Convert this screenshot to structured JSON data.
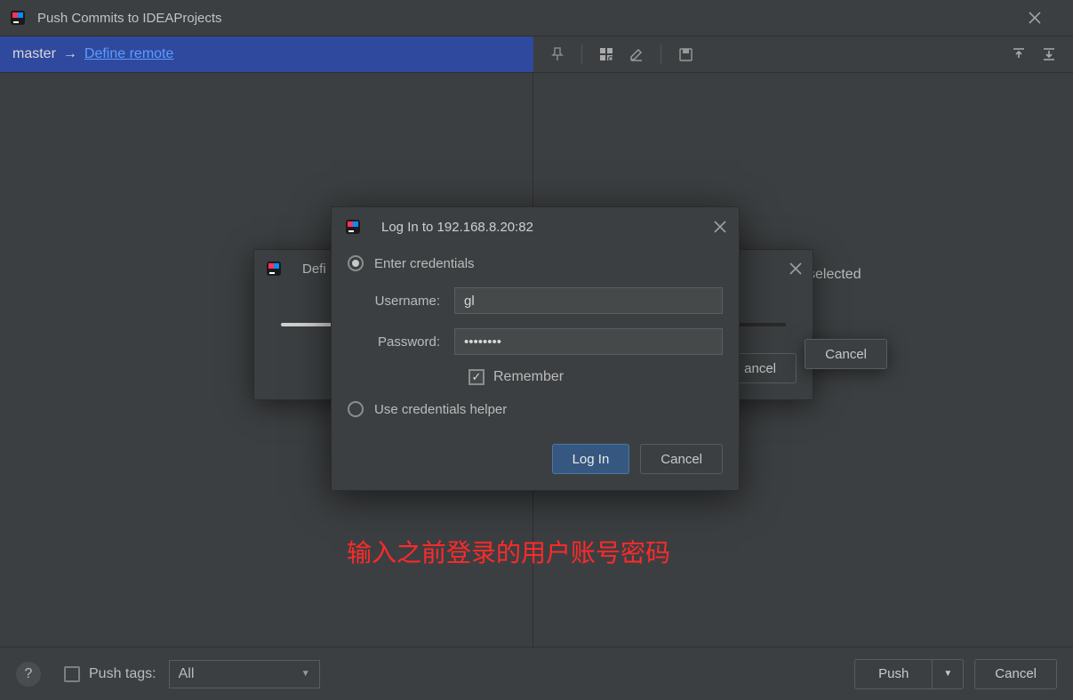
{
  "window": {
    "title": "Push Commits to IDEAProjects"
  },
  "branch_row": {
    "branch": "master",
    "arrow": "→",
    "define_remote": "Define remote"
  },
  "right_pane": {
    "selected_text": "selected"
  },
  "define_dialog": {
    "title_prefix": "Defi",
    "cancel_float": "Cancel",
    "cancel_btn_truncated": "ancel"
  },
  "login_dialog": {
    "title": "Log In to 192.168.8.20:82",
    "enter_credentials": "Enter credentials",
    "use_helper": "Use credentials helper",
    "username_label": "Username:",
    "username_value": "gl",
    "password_label": "Password:",
    "password_value": "••••••••",
    "remember_label": "Remember",
    "login_btn": "Log In",
    "cancel_btn": "Cancel"
  },
  "annotation": "输入之前登录的用户账号密码",
  "footer": {
    "push_tags_label": "Push tags:",
    "push_tags_value": "All",
    "push_btn": "Push",
    "cancel_btn": "Cancel"
  }
}
